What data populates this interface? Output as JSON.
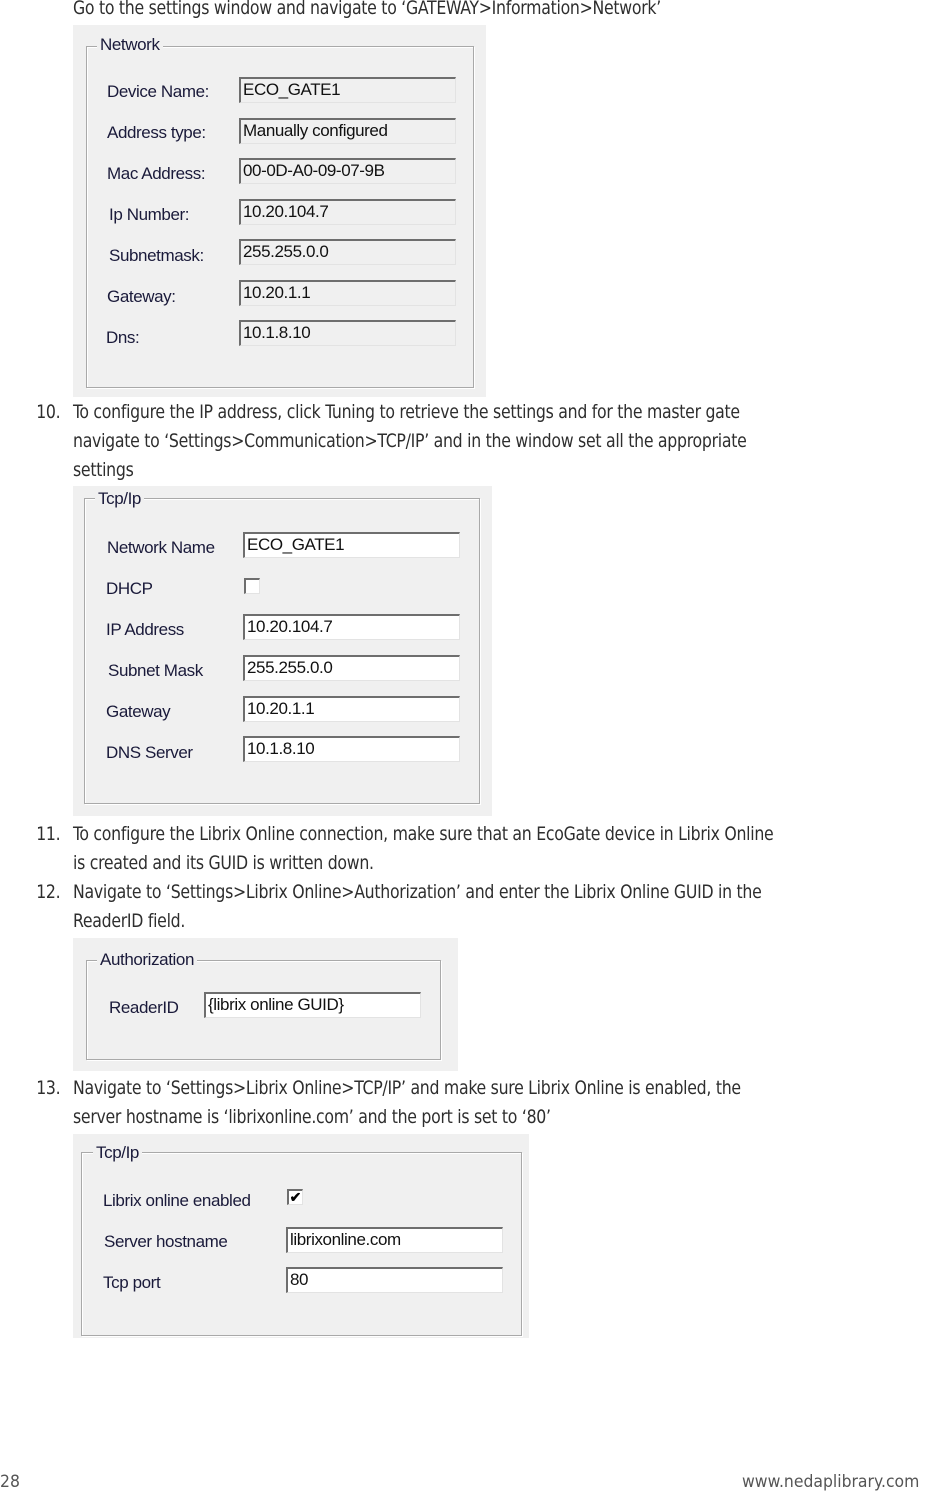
{
  "intro_text": "Go to the settings window and navigate to ‘GATEWAY>Information>Network’",
  "network_panel": {
    "title": "Network",
    "fields": [
      {
        "label": "Device Name:",
        "value": "ECO_GATE1"
      },
      {
        "label": "Address type:",
        "value": "Manually configured"
      },
      {
        "label": "Mac Address:",
        "value": "00-0D-A0-09-07-9B"
      },
      {
        "label": "Ip Number:",
        "value": "10.20.104.7"
      },
      {
        "label": "Subnetmask:",
        "value": "255.255.0.0"
      },
      {
        "label": "Gateway:",
        "value": "10.20.1.1"
      },
      {
        "label": "Dns:",
        "value": "10.1.8.10"
      }
    ]
  },
  "steps": [
    {
      "number": "10.",
      "lines": [
        "To configure the IP address, click Tuning to retrieve the settings and for the master gate",
        "navigate to ‘Settings>Communication>TCP/IP’ and in the window set all the appropriate",
        "settings"
      ]
    },
    {
      "number": "11.",
      "lines": [
        "To configure the Librix Online connection, make sure that an EcoGate device in Librix Online",
        "is created and its GUID is written down."
      ]
    },
    {
      "number": "12.",
      "lines": [
        "Navigate to ‘Settings>Librix Online>Authorization’ and enter the Librix Online GUID in the",
        "ReaderID field."
      ]
    },
    {
      "number": "13.",
      "lines": [
        "Navigate to ‘Settings>Librix Online>TCP/IP’ and make sure Librix Online is enabled, the",
        "server hostname is ‘librixonline.com’ and the port is set to ‘80’"
      ]
    }
  ],
  "tcpip_panel": {
    "title": "Tcp/Ip",
    "network_name_label": "Network Name",
    "network_name_value": "ECO_GATE1",
    "dhcp_label": "DHCP",
    "dhcp_checked": false,
    "ip_label": "IP Address",
    "ip_value": "10.20.104.7",
    "subnet_label": "Subnet Mask",
    "subnet_value": "255.255.0.0",
    "gateway_label": "Gateway",
    "gateway_value": "10.20.1.1",
    "dns_label": "DNS Server",
    "dns_value": "10.1.8.10"
  },
  "auth_panel": {
    "title": "Authorization",
    "reader_label": "ReaderID",
    "reader_value": "{librix online GUID}"
  },
  "librix_panel": {
    "title": "Tcp/Ip",
    "enabled_label": "Librix online enabled",
    "enabled_checked": true,
    "check_glyph": "✔",
    "hostname_label": "Server hostname",
    "hostname_value": "librixonline.com",
    "port_label": "Tcp port",
    "port_value": "80"
  },
  "footer": {
    "page_number": "28",
    "website": "www.nedaplibrary.com"
  }
}
